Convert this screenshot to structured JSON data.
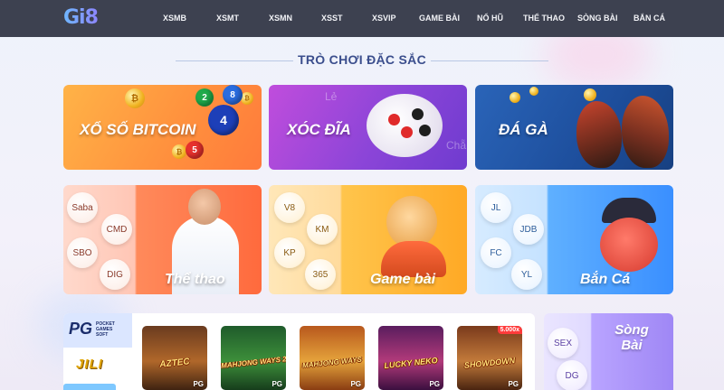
{
  "header": {
    "logo": "Gi8",
    "nav": [
      "XSMB",
      "XSMT",
      "XSMN",
      "XSST",
      "XSVIP",
      "GAME BÀI",
      "NỔ HŨ",
      "THỂ THAO",
      "SÒNG BÀI",
      "BẮN CÁ"
    ]
  },
  "section": {
    "title": "TRÒ CHƠI ĐẶC SẮC"
  },
  "banners": [
    {
      "label": "XỔ SỐ BITCOIN"
    },
    {
      "label": "XÓC ĐĨA"
    },
    {
      "label": "ĐÁ GÀ"
    }
  ],
  "lottery_balls": [
    "2",
    "8",
    "4",
    "5"
  ],
  "xocdia_marks": [
    "Lẻ",
    "Chẵ"
  ],
  "providers": {
    "thethao": {
      "label": "Thể thao",
      "items": [
        "Saba",
        "CMD",
        "SBO",
        "DIG"
      ]
    },
    "gamebai": {
      "label": "Game bài",
      "items": [
        "V8",
        "KM",
        "KP",
        "365"
      ]
    },
    "banca": {
      "label": "Bắn Cá",
      "items": [
        "JL",
        "JDB",
        "FC",
        "YL"
      ]
    }
  },
  "slots_panel": {
    "brand_pg": "PG",
    "brand_pg_sub": [
      "POCKET",
      "GAMES",
      "SOFT"
    ],
    "brand_jili": "JILI",
    "games": [
      {
        "name": "AZTEC",
        "mark": "PG",
        "badge": ""
      },
      {
        "name": "MAHJONG WAYS 2",
        "mark": "PG",
        "badge": ""
      },
      {
        "name": "MAHJONG WAYS",
        "mark": "PG",
        "badge": ""
      },
      {
        "name": "LUCKY NEKO",
        "mark": "PG",
        "badge": ""
      },
      {
        "name": "SHOWDOWN",
        "mark": "PG",
        "badge": "5.000x"
      }
    ]
  },
  "songbai": {
    "label_line1": "Sòng",
    "label_line2": "Bài",
    "items": [
      "SEX",
      "DG"
    ]
  },
  "colors": {
    "header_bg": "#3d4150",
    "title": "#3b4e8d",
    "bitcoin": "#ff8f3d",
    "xocdia": "#8c45d8",
    "daga": "#1d4e9c",
    "thethao": "#ff6a3d",
    "gamebai": "#ffa925",
    "banca": "#3a8fff",
    "songbai": "#9f87f5"
  }
}
